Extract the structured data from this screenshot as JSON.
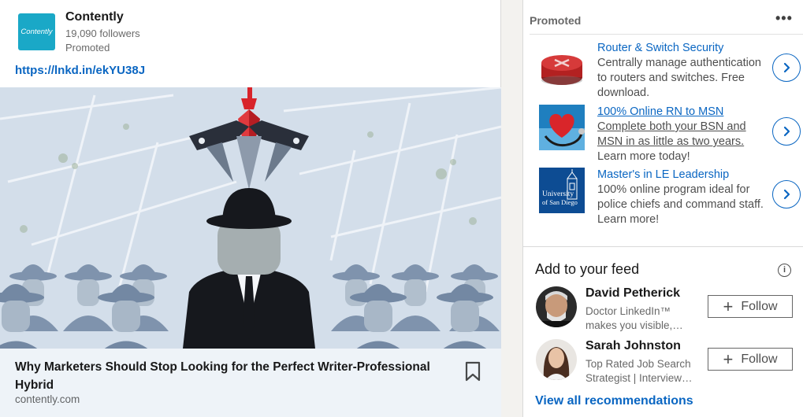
{
  "post": {
    "company": {
      "logo_text": "Contently",
      "name": "Contently",
      "followers": "19,090 followers",
      "promoted_label": "Promoted"
    },
    "link": "https://lnkd.in/ekYU38J",
    "image_icon": "claw-machine-over-bowler-hat-crowd-illustration",
    "article": {
      "title": "Why Marketers Should Stop Looking for the Perfect Writer-Professional Hybrid",
      "source": "contently.com",
      "bookmark_icon": "bookmark-icon"
    }
  },
  "promoted": {
    "header": "Promoted",
    "menu_icon": "ellipsis-icon",
    "ads": [
      {
        "thumb": "router-icon",
        "title": "Router & Switch Security",
        "description": "Centrally manage authentication to routers and switches. Free download."
      },
      {
        "thumb": "heart-stethoscope-icon",
        "title": "100% Online RN to MSN",
        "description_underlined": "Complete both your BSN and MSN in as little as two years.",
        "description": "Learn more today!"
      },
      {
        "thumb": "university-logo",
        "logo_line1": "University",
        "logo_line2": "of San Diego",
        "title": "Master's in LE Leadership",
        "description": "100% online program ideal for police chiefs and command staff. Learn more!"
      }
    ]
  },
  "feed": {
    "header": "Add to your feed",
    "info_icon": "i",
    "people": [
      {
        "name": "David Petherick",
        "headline": "Doctor LinkedIn™ makes you visible,…",
        "follow_label": "Follow"
      },
      {
        "name": "Sarah Johnston",
        "headline": "Top Rated Job Search Strategist | Interview…",
        "follow_label": "Follow"
      }
    ],
    "view_all": "View all recommendations"
  },
  "colors": {
    "link_blue": "#0a66c2",
    "logo_teal": "#1aa8c7",
    "footer_bg": "#eef3f8"
  }
}
